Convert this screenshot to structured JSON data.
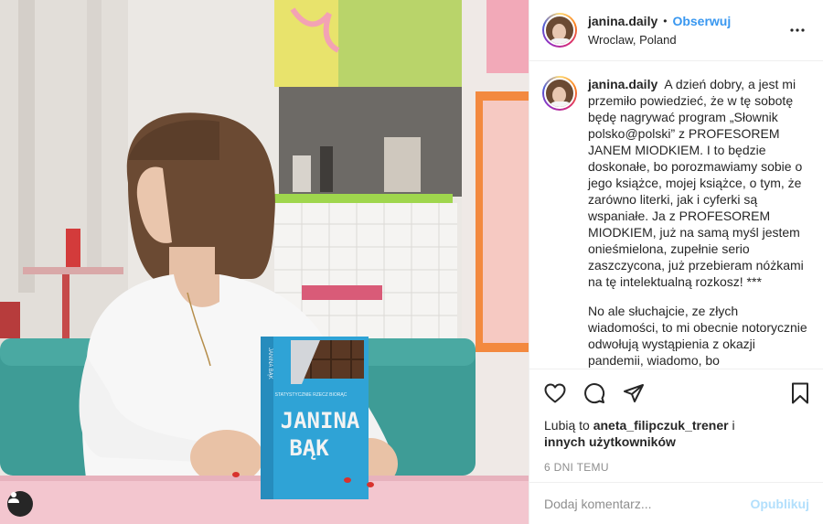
{
  "post": {
    "username": "janina.daily",
    "separator": "•",
    "follow_label": "Obserwuj",
    "location": "Wroclaw, Poland",
    "more_icon": "more-horizontal-icon"
  },
  "caption": {
    "username": "janina.daily",
    "paragraph1": "A dzień dobry, a jest mi przemiło powiedzieć, że w tę sobotę będę nagrywać program „Słownik polsko@polski” z PROFESOREM JANEM MIODKIEM. I to będzie doskonałe, bo porozmawiamy sobie o jego książce, mojej książce, o tym, że zarówno literki, jak i cyferki są wspaniałe. Ja z PROFESOREM MIODKIEM, już na samą myśl jestem onieśmielona, zupełnie serio zaszczycona, już przebieram nóżkami na tę intelektualną rozkosz! ***",
    "paragraph2": "No ale słuchajcie, ze złych wiadomości, to mi obecnie notorycznie odwołują wystąpienia z okazji pandemii, wiadomo, bo"
  },
  "actions": {
    "like_icon": "heart-icon",
    "comment_icon": "comment-icon",
    "share_icon": "share-icon",
    "save_icon": "bookmark-icon"
  },
  "likes": {
    "prefix": "Lubią to",
    "user": "aneta_filipczuk_trener",
    "suffix": "i",
    "others": "innych użytkowników"
  },
  "timestamp": "6 DNI TEMU",
  "comment": {
    "placeholder": "Dodaj komentarz...",
    "publish_label": "Opublikuj"
  },
  "photo": {
    "book_series": "STATYSTYCZNIE RZECZ BIORĄC",
    "book_author_line1": "JANINA",
    "book_author_line2": "BĄK",
    "book_spine": "JANINA BĄK",
    "colors": {
      "book_blue": "#2fa3d6",
      "table_pink": "#f3c6cf",
      "booth_teal": "#3e9c96",
      "accent_blue": "#3897f0"
    }
  }
}
